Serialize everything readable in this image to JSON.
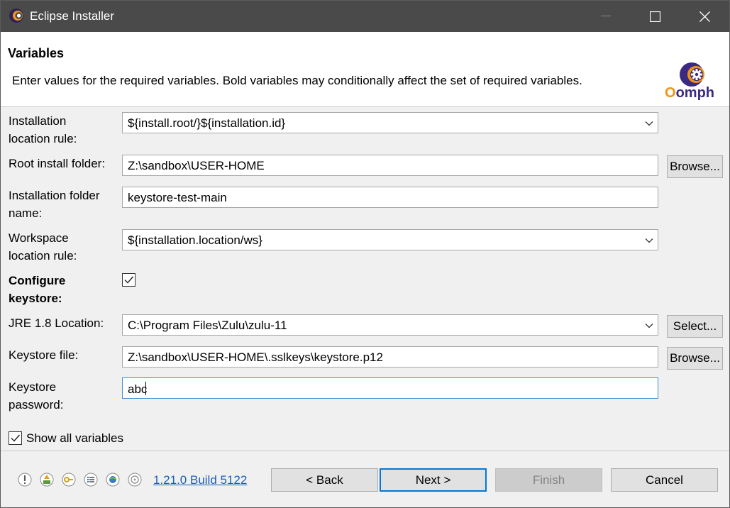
{
  "window": {
    "title": "Eclipse Installer"
  },
  "header": {
    "title": "Variables",
    "description": "Enter values for the required variables.  Bold variables may conditionally affect the set of required variables.",
    "logo_text": "Oomph"
  },
  "form": {
    "installation_location_rule": {
      "label_line1": "Installation",
      "label_line2": "location rule:",
      "value": "${install.root/}${installation.id}"
    },
    "root_install_folder": {
      "label": "Root install folder:",
      "value": "Z:\\sandbox\\USER-HOME",
      "button": "Browse..."
    },
    "installation_folder_name": {
      "label_line1": "Installation folder",
      "label_line2": "name:",
      "value": "keystore-test-main"
    },
    "workspace_location_rule": {
      "label_line1": "Workspace",
      "label_line2": "location rule:",
      "value": "${installation.location/ws}"
    },
    "configure_keystore": {
      "label_line1": "Configure",
      "label_line2": "keystore:",
      "checked": true
    },
    "jre_location": {
      "label": "JRE 1.8 Location:",
      "value": "C:\\Program Files\\Zulu\\zulu-11",
      "button": "Select..."
    },
    "keystore_file": {
      "label": "Keystore file:",
      "value": "Z:\\sandbox\\USER-HOME\\.sslkeys\\keystore.p12",
      "button": "Browse..."
    },
    "keystore_password": {
      "label_line1": "Keystore",
      "label_line2": "password:",
      "value": "abc"
    }
  },
  "show_all_variables": {
    "label": "Show all variables",
    "checked": true
  },
  "footer": {
    "icons": [
      "exclamation-icon",
      "update-icon",
      "key-icon",
      "list-icon",
      "network-proxy-icon",
      "ssh-icon"
    ],
    "version": "1.21.0 Build 5122",
    "back": "< Back",
    "next": "Next >",
    "finish": "Finish",
    "cancel": "Cancel"
  }
}
